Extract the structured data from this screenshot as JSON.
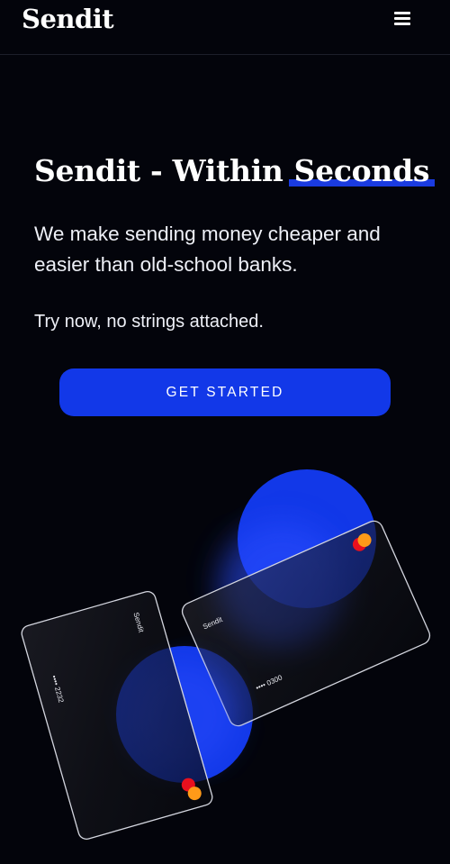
{
  "header": {
    "logo": "Sendit",
    "menu_icon": "hamburger-menu-icon"
  },
  "hero": {
    "title_main": "Sendit - Within",
    "title_highlight": "Seconds",
    "subtitle": "We make sending money cheaper and easier than old-school banks.",
    "note": "Try now, no strings attached.",
    "cta_label": "GET STARTED"
  },
  "cards": {
    "left": {
      "brand": "Sendit",
      "number": "•••• 2232"
    },
    "right": {
      "brand": "Sendit",
      "number": "•••• 0300"
    }
  },
  "colors": {
    "background": "#03040b",
    "accent": "#1238e8",
    "chip_red": "#e8101e",
    "chip_orange": "#ff9a18"
  }
}
